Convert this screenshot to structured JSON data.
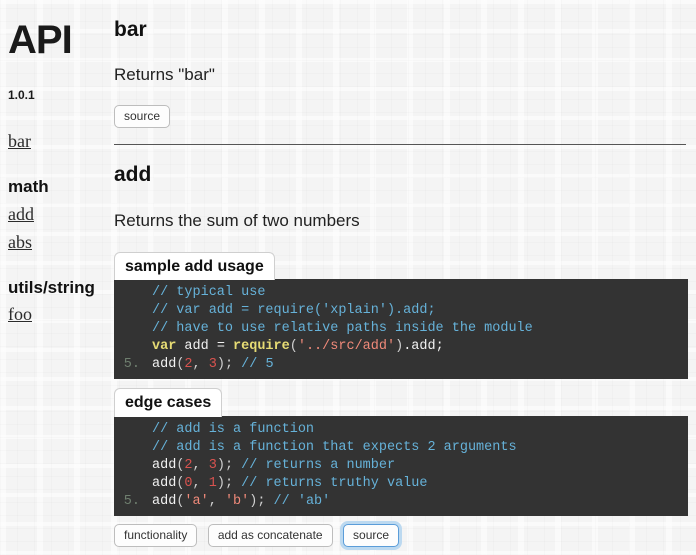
{
  "sidebar": {
    "brand": "API",
    "version": "1.0.1",
    "top_links": [
      {
        "label": "bar"
      }
    ],
    "groups": [
      {
        "title": "math",
        "links": [
          {
            "label": "add"
          },
          {
            "label": "abs"
          }
        ]
      },
      {
        "title": "utils/string",
        "links": [
          {
            "label": "foo"
          }
        ]
      }
    ]
  },
  "main": {
    "sections": [
      {
        "title": "bar",
        "description": "Returns \"bar\"",
        "source_button": "source"
      },
      {
        "title": "add",
        "description": "Returns the sum of two numbers"
      }
    ],
    "code_blocks": [
      {
        "tab_label": "sample add usage",
        "lines": [
          {
            "num": "",
            "tokens": [
              {
                "t": "com",
                "v": "// typical use"
              }
            ]
          },
          {
            "num": "",
            "tokens": [
              {
                "t": "com",
                "v": "// var add = require('xplain').add;"
              }
            ]
          },
          {
            "num": "",
            "tokens": [
              {
                "t": "com",
                "v": "// have to use relative paths inside the module"
              }
            ]
          },
          {
            "num": "",
            "tokens": [
              {
                "t": "kw",
                "v": "var"
              },
              {
                "t": "id",
                "v": " add = "
              },
              {
                "t": "fn",
                "v": "require"
              },
              {
                "t": "pun",
                "v": "("
              },
              {
                "t": "str",
                "v": "'../src/add'"
              },
              {
                "t": "pun",
                "v": ")"
              },
              {
                "t": "id",
                "v": ".add;"
              }
            ]
          },
          {
            "num": "5.",
            "tokens": [
              {
                "t": "id",
                "v": "add"
              },
              {
                "t": "pun",
                "v": "("
              },
              {
                "t": "num",
                "v": "2"
              },
              {
                "t": "pun",
                "v": ", "
              },
              {
                "t": "num",
                "v": "3"
              },
              {
                "t": "pun",
                "v": ");"
              },
              {
                "t": "com",
                "v": " // 5"
              }
            ]
          }
        ]
      },
      {
        "tab_label": "edge cases",
        "lines": [
          {
            "num": "",
            "tokens": [
              {
                "t": "com",
                "v": "// add is a function"
              }
            ]
          },
          {
            "num": "",
            "tokens": [
              {
                "t": "com",
                "v": "// add is a function that expects 2 arguments"
              }
            ]
          },
          {
            "num": "",
            "tokens": [
              {
                "t": "id",
                "v": "add"
              },
              {
                "t": "pun",
                "v": "("
              },
              {
                "t": "num",
                "v": "2"
              },
              {
                "t": "pun",
                "v": ", "
              },
              {
                "t": "num",
                "v": "3"
              },
              {
                "t": "pun",
                "v": ");"
              },
              {
                "t": "com",
                "v": " // returns a number"
              }
            ]
          },
          {
            "num": "",
            "tokens": [
              {
                "t": "id",
                "v": "add"
              },
              {
                "t": "pun",
                "v": "("
              },
              {
                "t": "num",
                "v": "0"
              },
              {
                "t": "pun",
                "v": ", "
              },
              {
                "t": "num",
                "v": "1"
              },
              {
                "t": "pun",
                "v": ");"
              },
              {
                "t": "com",
                "v": " // returns truthy value"
              }
            ]
          },
          {
            "num": "5.",
            "tokens": [
              {
                "t": "id",
                "v": "add"
              },
              {
                "t": "pun",
                "v": "("
              },
              {
                "t": "str",
                "v": "'a'"
              },
              {
                "t": "pun",
                "v": ", "
              },
              {
                "t": "str",
                "v": "'b'"
              },
              {
                "t": "pun",
                "v": ");"
              },
              {
                "t": "com",
                "v": " // 'ab'"
              }
            ]
          }
        ]
      }
    ],
    "bottom_tabs": [
      {
        "label": "functionality",
        "focused": false
      },
      {
        "label": "add as concatenate",
        "focused": false
      },
      {
        "label": "source",
        "focused": true
      }
    ]
  },
  "colors": {
    "page_background": "#f4f4f4",
    "code_background": "#333333",
    "comment": "#66b2d9",
    "keyword": "#e6db74",
    "string": "#f08a7a",
    "number": "#d9534f",
    "focus_ring": "#bcd9f0"
  }
}
